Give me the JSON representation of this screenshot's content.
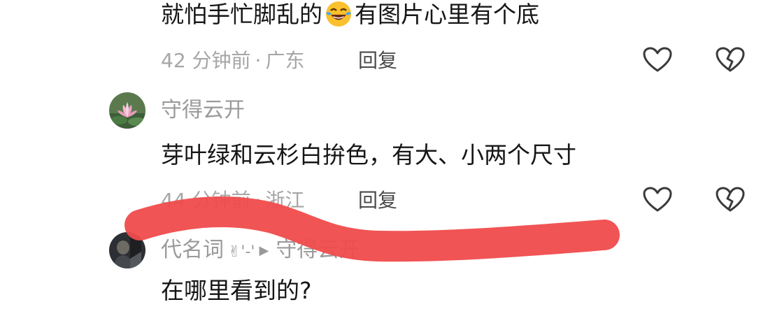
{
  "comments": [
    {
      "text_before_emoji": "就怕手忙脚乱的",
      "emoji": "laughing-with-tears-emoji",
      "text_after_emoji": "有图片心里有个底",
      "time": "42 分钟前",
      "location": "广东",
      "reply_label": "回复"
    },
    {
      "username": "守得云开",
      "text": "芽叶绿和云杉白拚色，有大、小两个尺寸",
      "time": "44 分钟前",
      "location": "浙江",
      "reply_label": "回复"
    },
    {
      "username": "代名词",
      "username_suffix": "✌'-'",
      "reply_to": "守得云开",
      "text": "在哪里看到的?"
    }
  ],
  "meta_separator": "·",
  "icons": {
    "like": "heart-outline-icon",
    "dislike": "broken-heart-icon",
    "reply_arrow": "play-arrow-icon"
  },
  "colors": {
    "scribble": "#f04b4b",
    "meta_text": "#a6a6a6",
    "body_text": "#161616"
  }
}
